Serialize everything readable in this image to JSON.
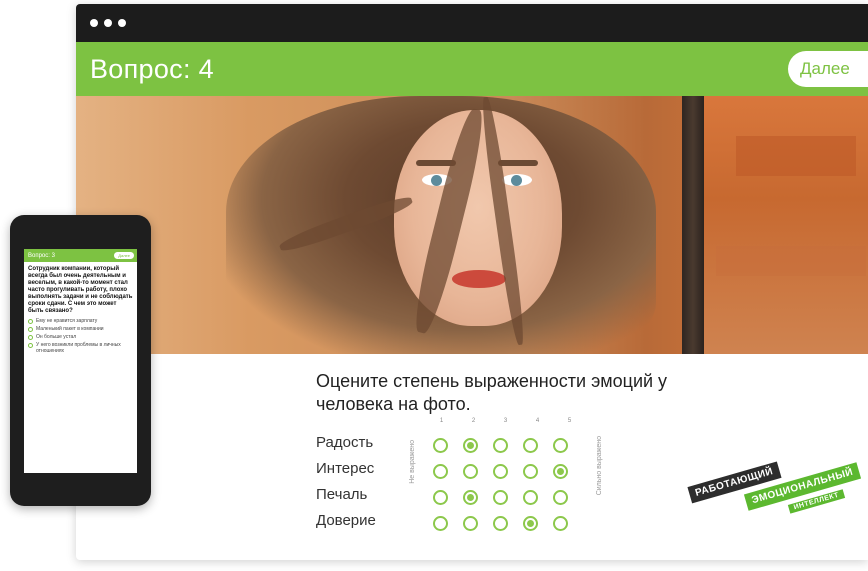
{
  "window": {
    "question_title": "Вопрос: 4",
    "next_label": "Далее"
  },
  "question": {
    "text": "Оцените степень выраженности эмоций у человека на фото.",
    "scale_numbers": [
      "1",
      "2",
      "3",
      "4",
      "5"
    ],
    "scale_min_label": "Не выражено",
    "scale_max_label": "Сильно выражено",
    "emotions": [
      {
        "label": "Радость",
        "selected": 2
      },
      {
        "label": "Интерес",
        "selected": 5
      },
      {
        "label": "Печаль",
        "selected": 2
      },
      {
        "label": "Доверие",
        "selected": 4
      }
    ]
  },
  "badge": {
    "line1": "РАБОТАЮЩИЙ",
    "line2": "ЭМОЦИОНАЛЬНЫЙ",
    "line3": "ИНТЕЛЛЕКТ"
  },
  "phone": {
    "title": "Вопрос: 3",
    "next_label": "Далее",
    "question": "Сотрудник компании, который всегда был очень деятельным и веселым, в какой-то момент стал часто прогуливать работу, плохо выполнять задачи и не соблюдать сроки сдачи. С чем это может быть связано?",
    "options": [
      "Ему не нравится зарплату",
      "Маленький пакет в компании",
      "Он больше устал",
      "У него возникли проблемы в личных отношениях"
    ]
  },
  "colors": {
    "accent_green": "#7dc242",
    "titlebar_dark": "#1c1c1c"
  }
}
